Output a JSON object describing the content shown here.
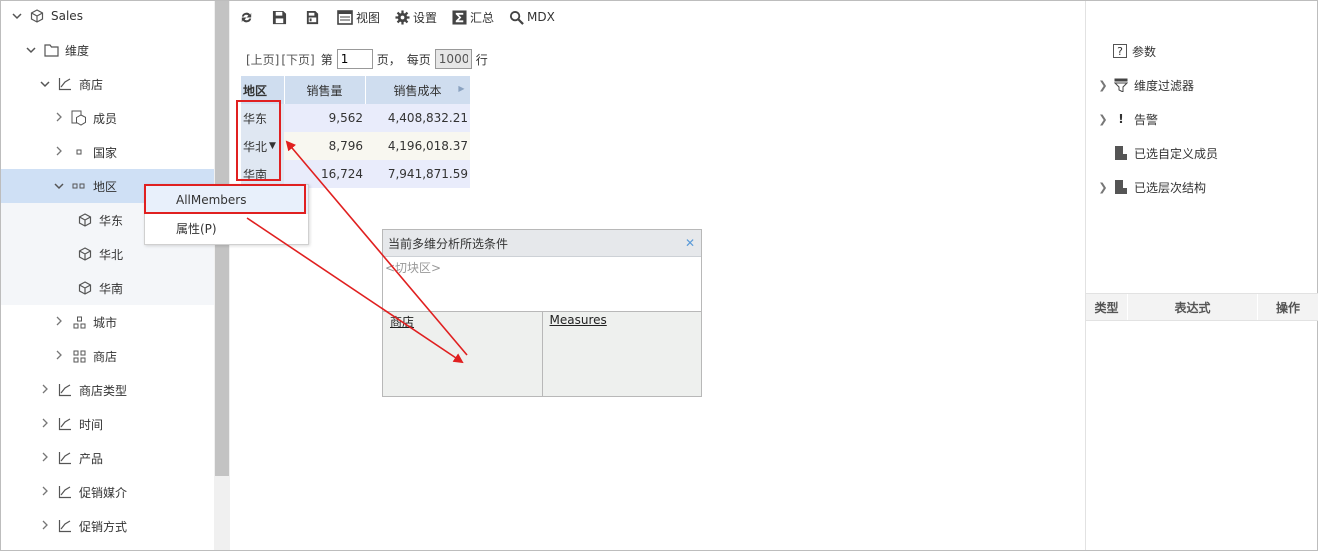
{
  "tree": {
    "items": [
      {
        "label": "Sales",
        "icon": "cube-icon",
        "chevron": "down",
        "level": 0
      },
      {
        "label": "维度",
        "icon": "folder-icon",
        "chevron": "down",
        "level": 1
      },
      {
        "label": "商店",
        "icon": "hierarchy-icon",
        "chevron": "down",
        "level": 2
      },
      {
        "label": "成员",
        "icon": "members-cube-icon",
        "chevron": "right",
        "level": 3
      },
      {
        "label": "国家",
        "icon": "level-1-icon",
        "chevron": "right",
        "level": 3
      },
      {
        "label": "地区",
        "icon": "level-2-icon",
        "chevron": "down",
        "level": 3,
        "selected": true
      },
      {
        "label": "华东",
        "icon": "member-cube-icon",
        "chevron": "",
        "level": 4
      },
      {
        "label": "华北",
        "icon": "member-cube-icon",
        "chevron": "",
        "level": 4
      },
      {
        "label": "华南",
        "icon": "member-cube-icon",
        "chevron": "",
        "level": 4
      },
      {
        "label": "城市",
        "icon": "level-3-icon",
        "chevron": "right",
        "level": 3
      },
      {
        "label": "商店",
        "icon": "level-4-icon",
        "chevron": "right",
        "level": 3
      },
      {
        "label": "商店类型",
        "icon": "hierarchy-icon",
        "chevron": "right",
        "level": 2
      },
      {
        "label": "时间",
        "icon": "hierarchy-icon",
        "chevron": "right",
        "level": 2
      },
      {
        "label": "产品",
        "icon": "hierarchy-icon",
        "chevron": "right",
        "level": 2
      },
      {
        "label": "促销媒介",
        "icon": "hierarchy-icon",
        "chevron": "right",
        "level": 2
      },
      {
        "label": "促销方式",
        "icon": "hierarchy-icon",
        "chevron": "right",
        "level": 2
      }
    ]
  },
  "toolbar": {
    "view_label": "视图",
    "settings_label": "设置",
    "summary_label": "汇总",
    "mdx_label": "MDX"
  },
  "pager": {
    "prev": "[上页]",
    "next": "[下页]",
    "page_prefix": "第",
    "page_value": "1",
    "page_suffix": "页，",
    "per_page_prefix": "每页",
    "per_page_value": "1000",
    "per_page_suffix": "行"
  },
  "grid": {
    "headers": [
      "地区",
      "销售量",
      "销售成本"
    ],
    "rows": [
      {
        "label": "华东",
        "qty": "9,562",
        "cost": "4,408,832.21"
      },
      {
        "label": "华北",
        "qty": "8,796",
        "cost": "4,196,018.37"
      },
      {
        "label": "华南",
        "qty": "16,724",
        "cost": "7,941,871.59"
      }
    ]
  },
  "context_menu": {
    "items": [
      "AllMembers",
      "属性(P)"
    ]
  },
  "conditions": {
    "title": "当前多维分析所选条件",
    "slice_placeholder": "<切块区>",
    "rows_axis": "商店",
    "cols_axis": "Measures"
  },
  "right_panel": {
    "items": [
      {
        "label": "参数",
        "icon": "param-icon",
        "chevron": ""
      },
      {
        "label": "维度过滤器",
        "icon": "filter-icon",
        "chevron": "right"
      },
      {
        "label": "告警",
        "icon": "alert-icon",
        "chevron": "right"
      },
      {
        "label": "已选自定义成员",
        "icon": "custom-member-icon",
        "chevron": ""
      },
      {
        "label": "已选层次结构",
        "icon": "hierarchy-selected-icon",
        "chevron": "right"
      }
    ],
    "table_headers": [
      "类型",
      "表达式",
      "操作"
    ]
  },
  "colors": {
    "selected_row": "#cfe0f5",
    "grid_header": "#cfddef",
    "annotation_red": "#e02020",
    "close_blue": "#5a9ad8"
  }
}
